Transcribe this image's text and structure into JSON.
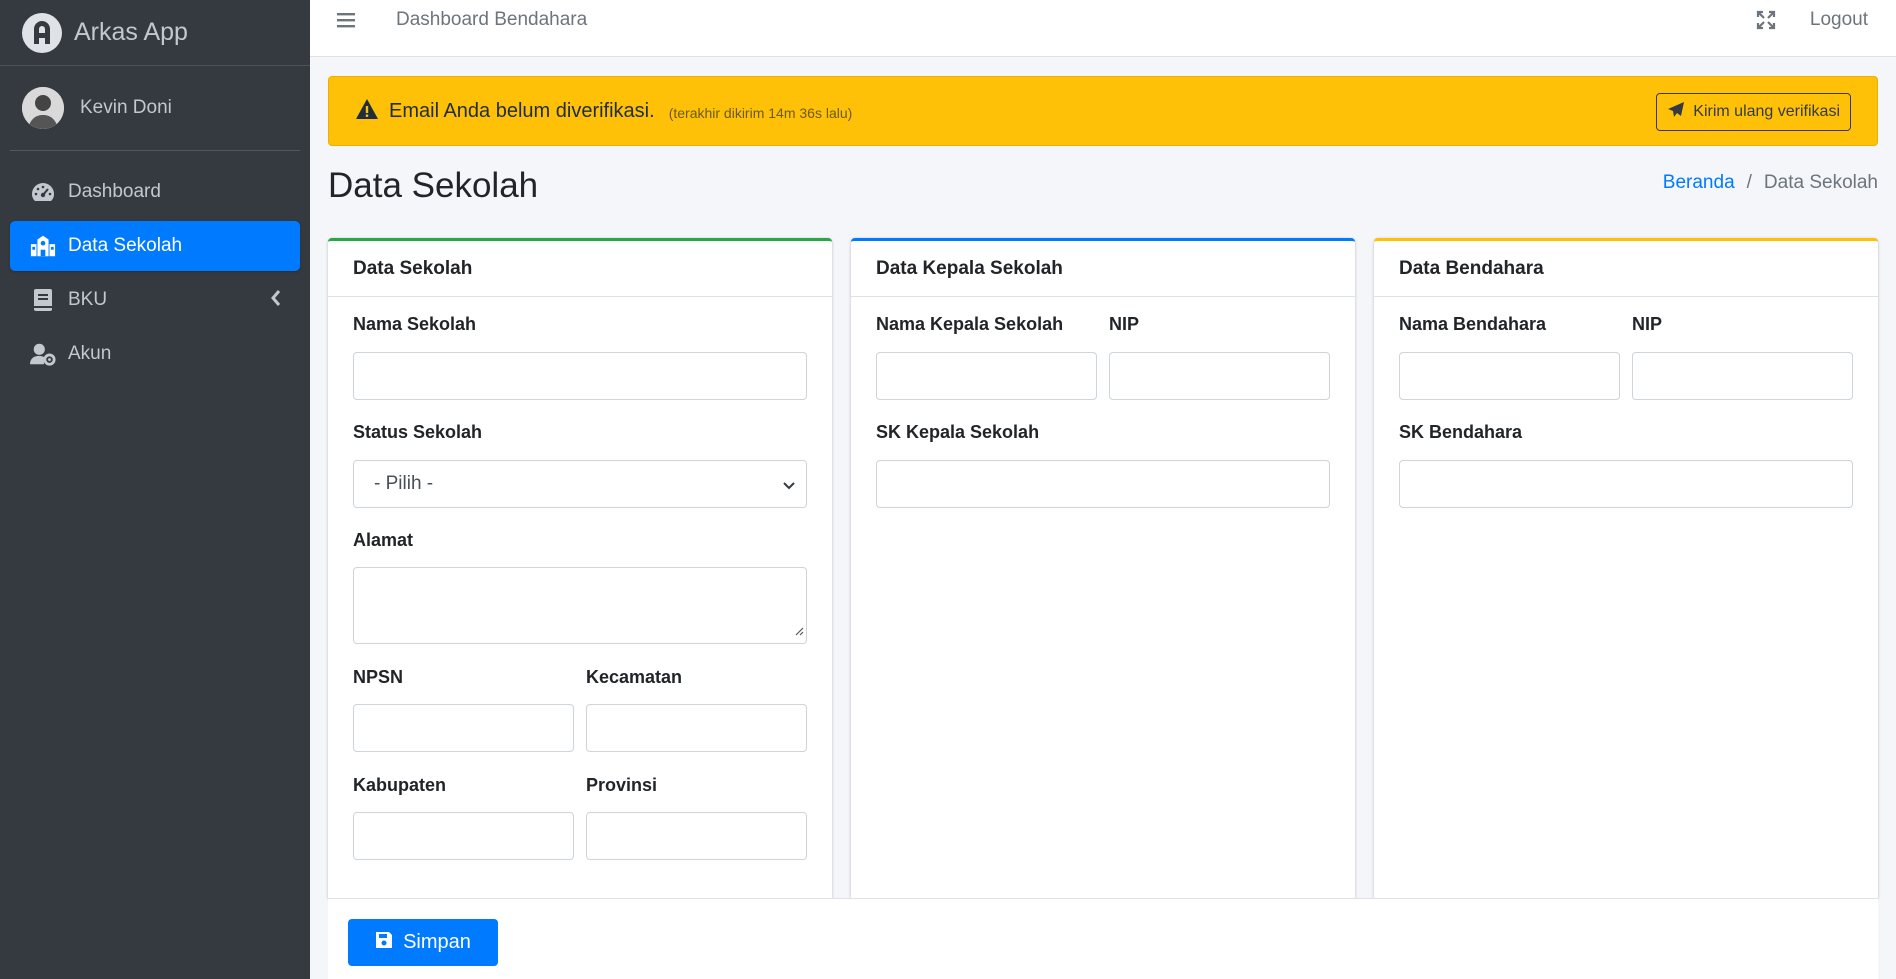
{
  "app": {
    "brand": "Arkas App",
    "user_name": "Kevin Doni"
  },
  "sidebar": {
    "items": [
      {
        "label": "Dashboard",
        "icon": "tachometer-icon",
        "active": false
      },
      {
        "label": "Data Sekolah",
        "icon": "school-icon",
        "active": true
      },
      {
        "label": "BKU",
        "icon": "book-icon",
        "active": false,
        "has_submenu": true
      },
      {
        "label": "Akun",
        "icon": "user-cog-icon",
        "active": false
      }
    ]
  },
  "topbar": {
    "title": "Dashboard Bendahara",
    "logout": "Logout"
  },
  "alert": {
    "message": "Email Anda belum diverifikasi.",
    "detail": "(terakhir dikirim 14m 36s lalu)",
    "button": "Kirim ulang verifikasi"
  },
  "page": {
    "title": "Data Sekolah"
  },
  "breadcrumb": {
    "home": "Beranda",
    "separator": "/",
    "current": "Data Sekolah"
  },
  "cards": {
    "sekolah": {
      "title": "Data Sekolah",
      "nama_label": "Nama Sekolah",
      "status_label": "Status Sekolah",
      "status_value": "- Pilih -",
      "alamat_label": "Alamat",
      "npsn_label": "NPSN",
      "kecamatan_label": "Kecamatan",
      "kabupaten_label": "Kabupaten",
      "provinsi_label": "Provinsi"
    },
    "kepala": {
      "title": "Data Kepala Sekolah",
      "nama_label": "Nama Kepala Sekolah",
      "nip_label": "NIP",
      "sk_label": "SK Kepala Sekolah"
    },
    "bendahara": {
      "title": "Data Bendahara",
      "nama_label": "Nama Bendahara",
      "nip_label": "NIP",
      "sk_label": "SK Bendahara"
    }
  },
  "footer": {
    "save": "Simpan"
  },
  "colors": {
    "primary": "#007bff",
    "warning": "#ffc107",
    "success": "#28a745",
    "sidebar": "#343a40"
  }
}
